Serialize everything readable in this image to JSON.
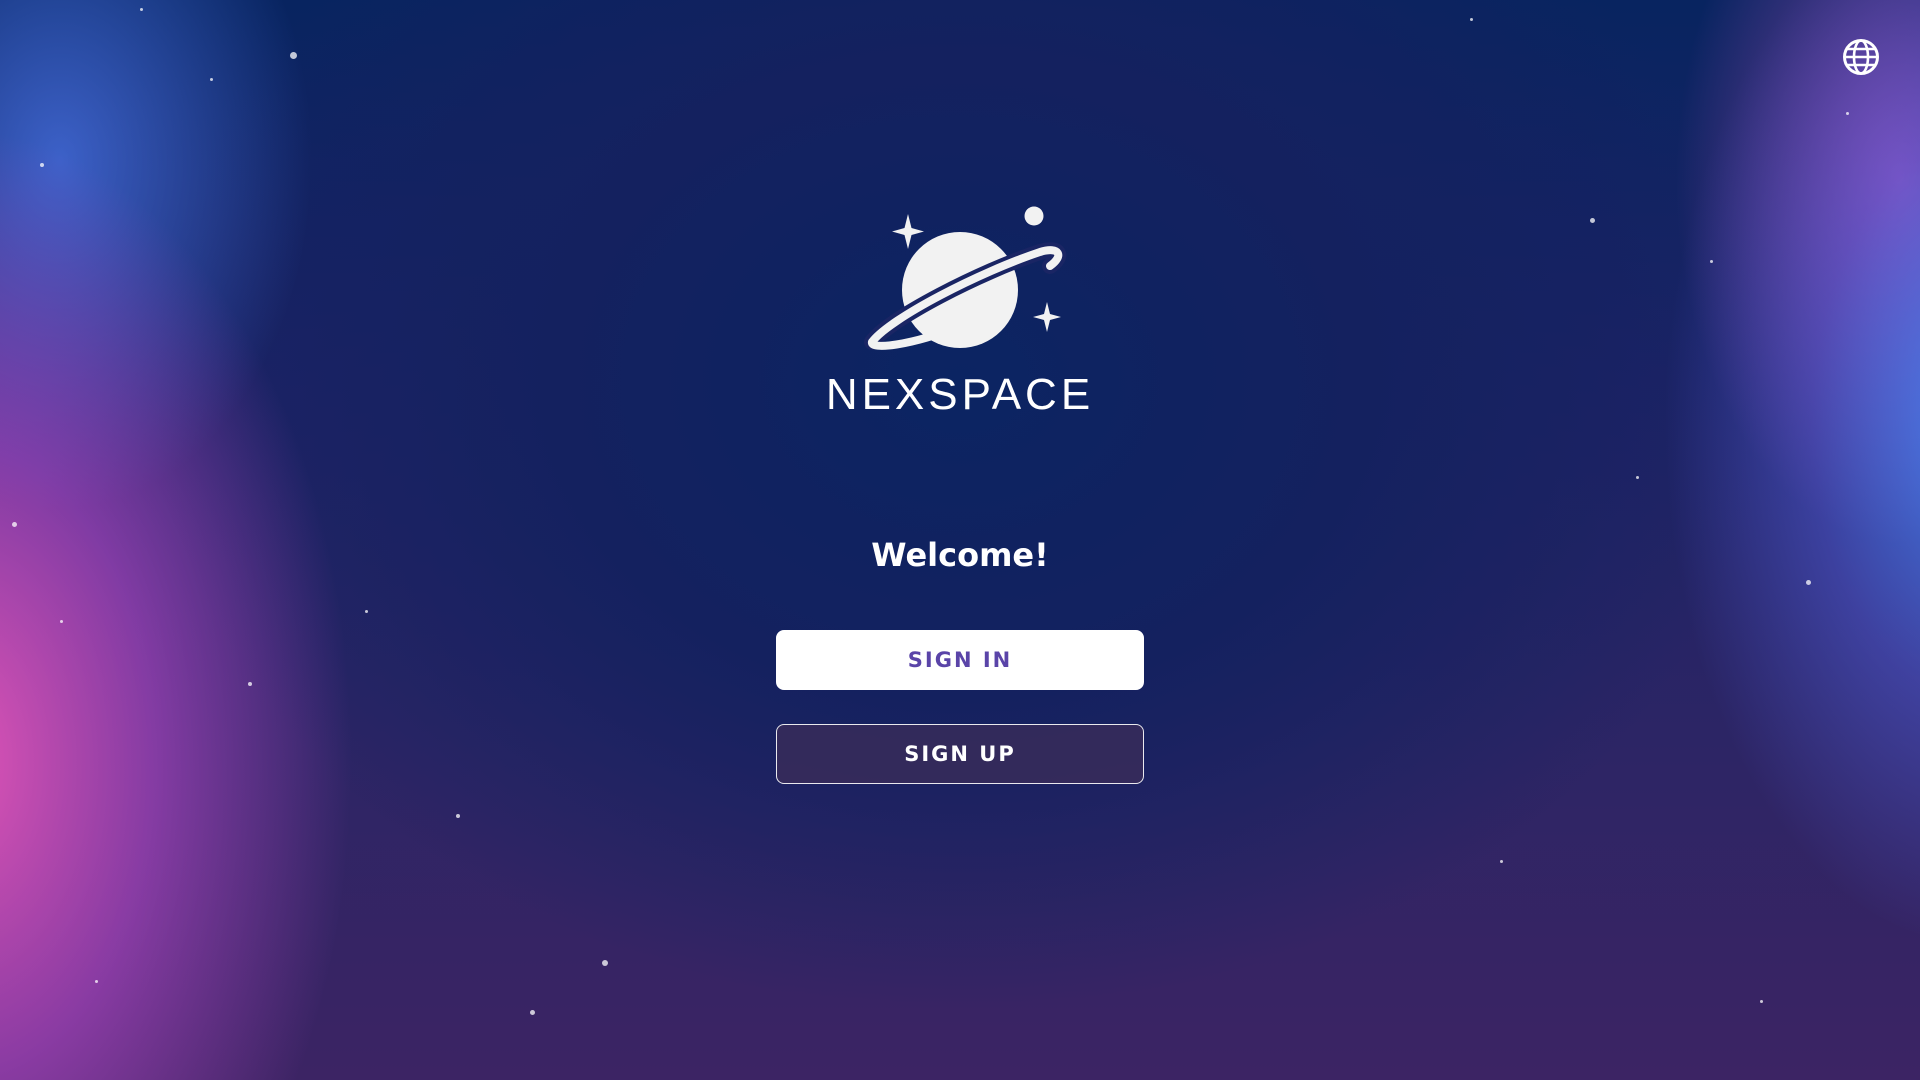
{
  "brand": {
    "name": "NEXSPACE",
    "logo_icon": "planet-icon"
  },
  "header": {
    "language_icon": "globe-icon"
  },
  "main": {
    "welcome": "Welcome!",
    "sign_in_label": "SIGN IN",
    "sign_up_label": "SIGN UP"
  },
  "colors": {
    "sign_in_text": "#5a44a8",
    "background_top": "#082460",
    "background_bottom": "#3c2464",
    "accent_pink": "#ff5cc4",
    "accent_blue": "#4a8cff"
  }
}
